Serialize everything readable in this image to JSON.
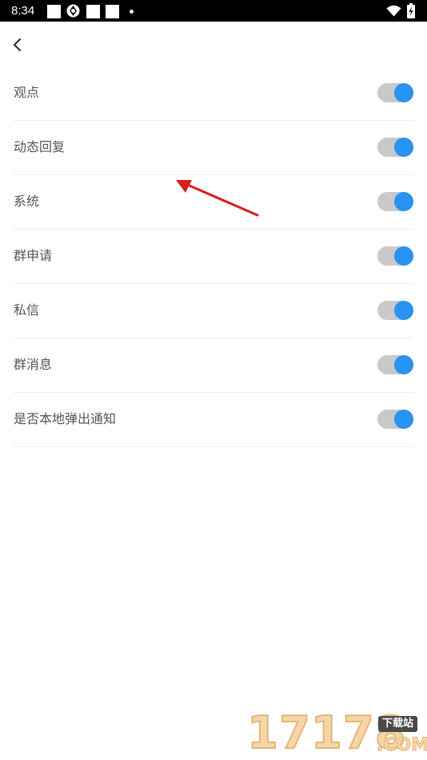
{
  "status_bar": {
    "time": "8:34",
    "icons": [
      "notification-square-icon",
      "sync-icon",
      "notification-square-icon",
      "notification-square-icon",
      "dot-icon",
      "wifi-icon",
      "battery-charging-icon"
    ]
  },
  "header": {
    "back_icon": "chevron-left-icon"
  },
  "settings": [
    {
      "label": "观点",
      "enabled": true
    },
    {
      "label": "动态回复",
      "enabled": true
    },
    {
      "label": "系统",
      "enabled": true
    },
    {
      "label": "群申请",
      "enabled": true
    },
    {
      "label": "私信",
      "enabled": true
    },
    {
      "label": "群消息",
      "enabled": true
    },
    {
      "label": "是否本地弹出通知",
      "enabled": true
    }
  ],
  "colors": {
    "toggle_on": "#2793f3",
    "toggle_track": "#c9c9c9",
    "label_text": "#555555",
    "annotation_arrow": "#d81e1e"
  },
  "watermark": {
    "digits": "17178",
    "tag": "下载站",
    "domain": ".COM"
  }
}
